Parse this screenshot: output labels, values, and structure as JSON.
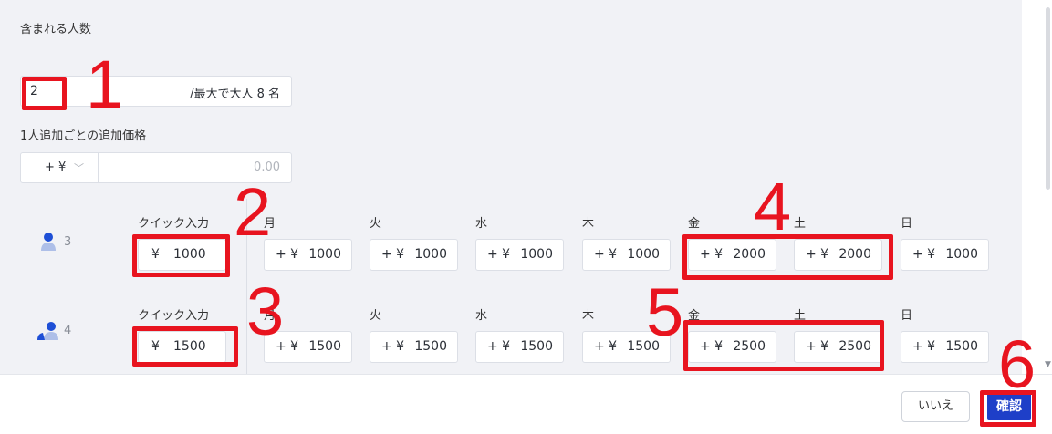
{
  "form": {
    "people_included_label": "含まれる人数",
    "people_value": "2",
    "people_suffix": "/最大で大人 8 名",
    "extra_price_label": "1人追加ごとの追加価格",
    "extra_currency": "+ ¥",
    "extra_price_placeholder": "0.00"
  },
  "rows": [
    {
      "people": "3",
      "quick_input_label": "クイック入力",
      "quick_currency": "¥",
      "quick_value": "1000",
      "days": [
        {
          "label": "月",
          "sign": "+ ¥",
          "value": "1000"
        },
        {
          "label": "火",
          "sign": "+ ¥",
          "value": "1000"
        },
        {
          "label": "水",
          "sign": "+ ¥",
          "value": "1000"
        },
        {
          "label": "木",
          "sign": "+ ¥",
          "value": "1000"
        },
        {
          "label": "金",
          "sign": "+ ¥",
          "value": "2000"
        },
        {
          "label": "土",
          "sign": "+ ¥",
          "value": "2000"
        },
        {
          "label": "日",
          "sign": "+ ¥",
          "value": "1000"
        }
      ]
    },
    {
      "people": "4",
      "quick_input_label": "クイック入力",
      "quick_currency": "¥",
      "quick_value": "1500",
      "days": [
        {
          "label": "月",
          "sign": "+ ¥",
          "value": "1500"
        },
        {
          "label": "火",
          "sign": "+ ¥",
          "value": "1500"
        },
        {
          "label": "水",
          "sign": "+ ¥",
          "value": "1500"
        },
        {
          "label": "木",
          "sign": "+ ¥",
          "value": "1500"
        },
        {
          "label": "金",
          "sign": "+ ¥",
          "value": "2500"
        },
        {
          "label": "土",
          "sign": "+ ¥",
          "value": "2500"
        },
        {
          "label": "日",
          "sign": "+ ¥",
          "value": "1500"
        }
      ]
    }
  ],
  "annotations": {
    "n1": "1",
    "n2": "2",
    "n3": "3",
    "n4": "4",
    "n5": "5",
    "n6": "6"
  },
  "footer": {
    "cancel_label": "いいえ",
    "confirm_label": "確認"
  },
  "icons": {
    "person_single": "person-icon",
    "person_group": "people-icon",
    "dropdown": "chevron-down-icon"
  },
  "colors": {
    "annotation_red": "#e8141f",
    "confirm_blue": "#1e3fc8",
    "icon_blue": "#1e4fd6",
    "icon_light": "#aebfe8"
  }
}
